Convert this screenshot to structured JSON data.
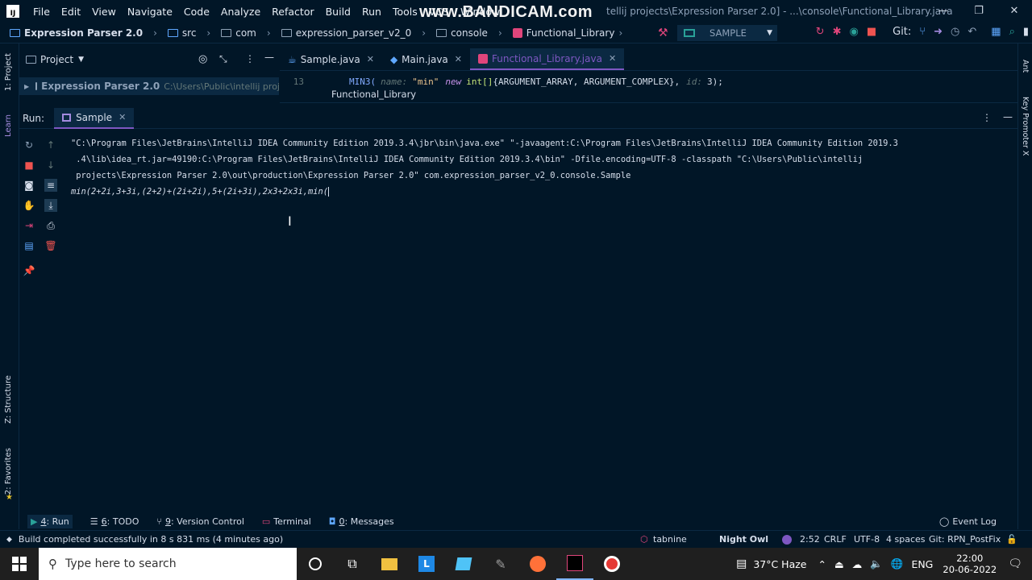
{
  "menu": [
    "File",
    "Edit",
    "View",
    "Navigate",
    "Code",
    "Analyze",
    "Refactor",
    "Build",
    "Run",
    "Tools",
    "VCS",
    "Window",
    "Help"
  ],
  "watermark": "www.BANDICAM.com",
  "window_title": "tellij projects\\Expression Parser 2.0] - ...\\console\\Functional_Library.java",
  "nav": {
    "project": "Expression Parser 2.0",
    "path": [
      "src",
      "com",
      "expression_parser_v2_0",
      "console"
    ],
    "file": "Functional_Library",
    "run_config": "SAMPLE",
    "git_label": "Git:"
  },
  "left_strip": {
    "project": "1: Project",
    "learn": "Learn",
    "structure": "Z: Structure",
    "favorites": "2: Favorites"
  },
  "right_strip": {
    "ant": "Ant",
    "key_promoter": "Key Promoter X"
  },
  "project_panel": {
    "title": "Project",
    "root_name": "Expression Parser 2.0",
    "root_path": "C:\\Users\\Public\\intellij projects\\Ex"
  },
  "editor_tabs": [
    {
      "label": "Sample.java",
      "active": false
    },
    {
      "label": "Main.java",
      "active": false
    },
    {
      "label": "Functional_Library.java",
      "active": true
    }
  ],
  "code": {
    "line_no": "13",
    "call": "MIN3(",
    "hint_name": "name:",
    "str": "\"min\"",
    "kw_new": "new",
    "type": "int[]",
    "args": "{ARGUMENT_ARRAY, ARGUMENT_COMPLEX},",
    "hint_id": "id:",
    "tail": "3);"
  },
  "editor_breadcrumb": "Functional_Library",
  "run": {
    "label": "Run:",
    "tab": "Sample"
  },
  "console": {
    "line1": "\"C:\\Program Files\\JetBrains\\IntelliJ IDEA Community Edition 2019.3.4\\jbr\\bin\\java.exe\" \"-javaagent:C:\\Program Files\\JetBrains\\IntelliJ IDEA Community Edition 2019.3",
    "line2": " .4\\lib\\idea_rt.jar=49190:C:\\Program Files\\JetBrains\\IntelliJ IDEA Community Edition 2019.3.4\\bin\" -Dfile.encoding=UTF-8 -classpath \"C:\\Users\\Public\\intellij",
    "line3": " projects\\Expression Parser 2.0\\out\\production\\Expression Parser 2.0\" com.expression_parser_v2_0.console.Sample",
    "input": "min(2+2i,3+3i,(2+2)+(2i+2i),5+(2i+3i),2x3+2x3i,min("
  },
  "bottom_tabs": [
    {
      "key": "4",
      "label": ": Run"
    },
    {
      "key": "6",
      "label": ": TODO"
    },
    {
      "key": "9",
      "label": ": Version Control"
    },
    {
      "key": "",
      "label": "Terminal"
    },
    {
      "key": "0",
      "label": ": Messages"
    }
  ],
  "event_log": "Event Log",
  "status": {
    "message": "Build completed successfully in 8 s 831 ms (4 minutes ago)",
    "tabnine": "tabnine",
    "theme": "Night Owl",
    "position": "2:52",
    "line_sep": "CRLF",
    "encoding": "UTF-8",
    "indent": "4 spaces",
    "git_branch": "Git: RPN_PostFix"
  },
  "taskbar": {
    "search_placeholder": "Type here to search",
    "weather": "37°C  Haze",
    "lang": "ENG",
    "time": "22:00",
    "date": "20-06-2022"
  }
}
